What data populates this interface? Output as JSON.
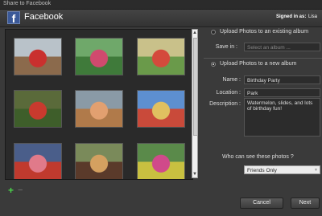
{
  "window": {
    "title": "Share to Facebook"
  },
  "header": {
    "brand": "Facebook",
    "logo_letter": "f",
    "signed_in_label": "Signed in as:",
    "user": "Lisa"
  },
  "gallery": {
    "photos": [
      {
        "sky": "#b9c2c9",
        "ground": "#8b6a4c",
        "person": "#c9302e"
      },
      {
        "sky": "#6fa86a",
        "ground": "#3f7a3a",
        "person": "#d04a6e"
      },
      {
        "sky": "#c9c18a",
        "ground": "#6a9a4a",
        "person": "#d44a3c"
      },
      {
        "sky": "#5a6a3a",
        "ground": "#3e5e2a",
        "person": "#c93a2e"
      },
      {
        "sky": "#8a9aa6",
        "ground": "#b07a4a",
        "person": "#e2a070"
      },
      {
        "sky": "#5d8fd0",
        "ground": "#c94a3a",
        "person": "#e0c060"
      },
      {
        "sky": "#4a5e8a",
        "ground": "#c03a2e",
        "person": "#e07a8a"
      },
      {
        "sky": "#7a8a5a",
        "ground": "#5a3a2a",
        "person": "#d4a060"
      },
      {
        "sky": "#5a8a4a",
        "ground": "#c8c040",
        "person": "#d04a8a"
      }
    ],
    "add_icon": "plus-icon",
    "remove_icon": "minus-icon"
  },
  "panel": {
    "existing_option": "Upload Photos to an existing album",
    "save_in_label": "Save in :",
    "save_in_placeholder": "Select an album ...",
    "new_option": "Upload Photos to a new album",
    "name_label": "Name :",
    "name_value": "Birthday Party",
    "location_label": "Location :",
    "location_value": "Park",
    "description_label": "Description :",
    "description_value": "Watermelon, slides, and lots of birthday fun!",
    "privacy_question": "Who can see these photos ?",
    "privacy_value": "Friends Only"
  },
  "buttons": {
    "cancel": "Cancel",
    "next": "Next"
  }
}
